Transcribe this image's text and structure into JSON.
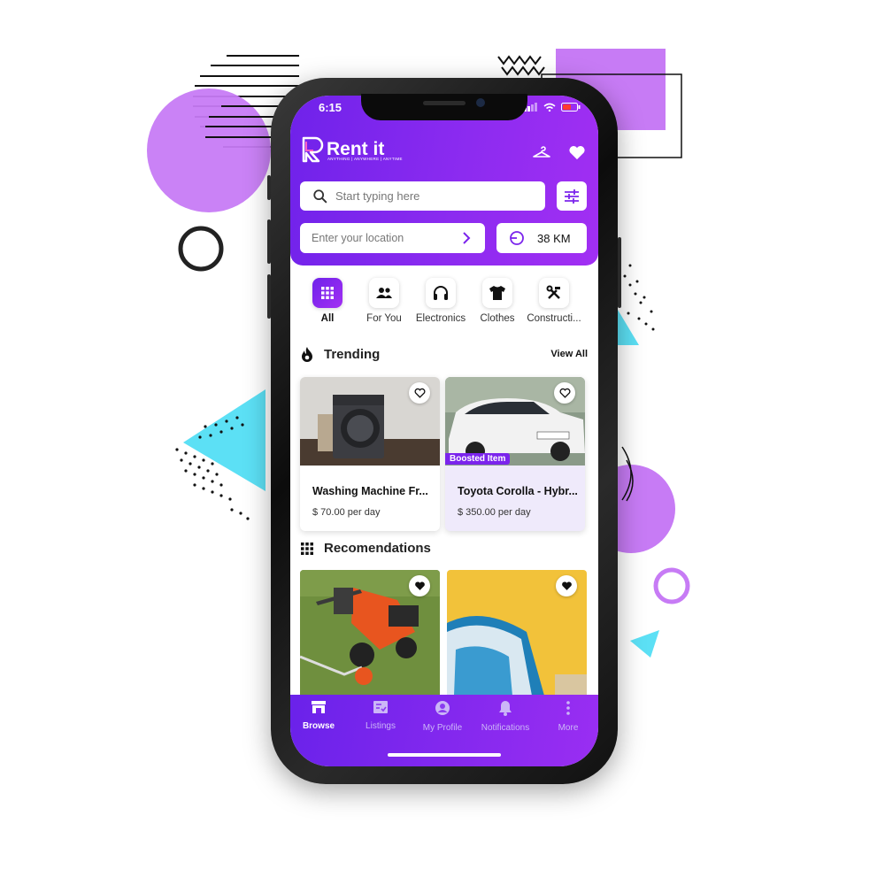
{
  "colors": {
    "accent": "#7b24ec",
    "deco_purple": "#c77bf5",
    "deco_cyan": "#5ce0f5"
  },
  "status": {
    "time": "6:15"
  },
  "app": {
    "brand": "Rent it",
    "tagline": "ANYTHING | ANYWHERE | ANYTIME"
  },
  "header": {
    "icons": [
      "hanger-icon",
      "heart-icon"
    ]
  },
  "search": {
    "placeholder": "Start typing here"
  },
  "location": {
    "placeholder": "Enter your location",
    "radius": "38 KM"
  },
  "categories": [
    {
      "label": "All",
      "icon": "grid-icon",
      "active": true
    },
    {
      "label": "For You",
      "icon": "people-icon"
    },
    {
      "label": "Electronics",
      "icon": "headphones-icon"
    },
    {
      "label": "Clothes",
      "icon": "tshirt-icon"
    },
    {
      "label": "Constructi...",
      "icon": "tools-icon"
    }
  ],
  "trending": {
    "title": "Trending",
    "view_all": "View All",
    "items": [
      {
        "name": "Washing Machine Fr...",
        "price": "$ 70.00 per day"
      },
      {
        "name": "Toyota Corolla - Hybr...",
        "price": "$ 350.00 per day",
        "badge": "Boosted Item"
      }
    ]
  },
  "recommendations": {
    "title": "Recomendations"
  },
  "tabs": [
    {
      "label": "Browse",
      "icon": "store-icon",
      "active": true
    },
    {
      "label": "Listings",
      "icon": "listings-icon"
    },
    {
      "label": "My Profile",
      "icon": "profile-icon"
    },
    {
      "label": "Notifications",
      "icon": "bell-icon"
    },
    {
      "label": "More",
      "icon": "more-vertical-icon"
    }
  ]
}
